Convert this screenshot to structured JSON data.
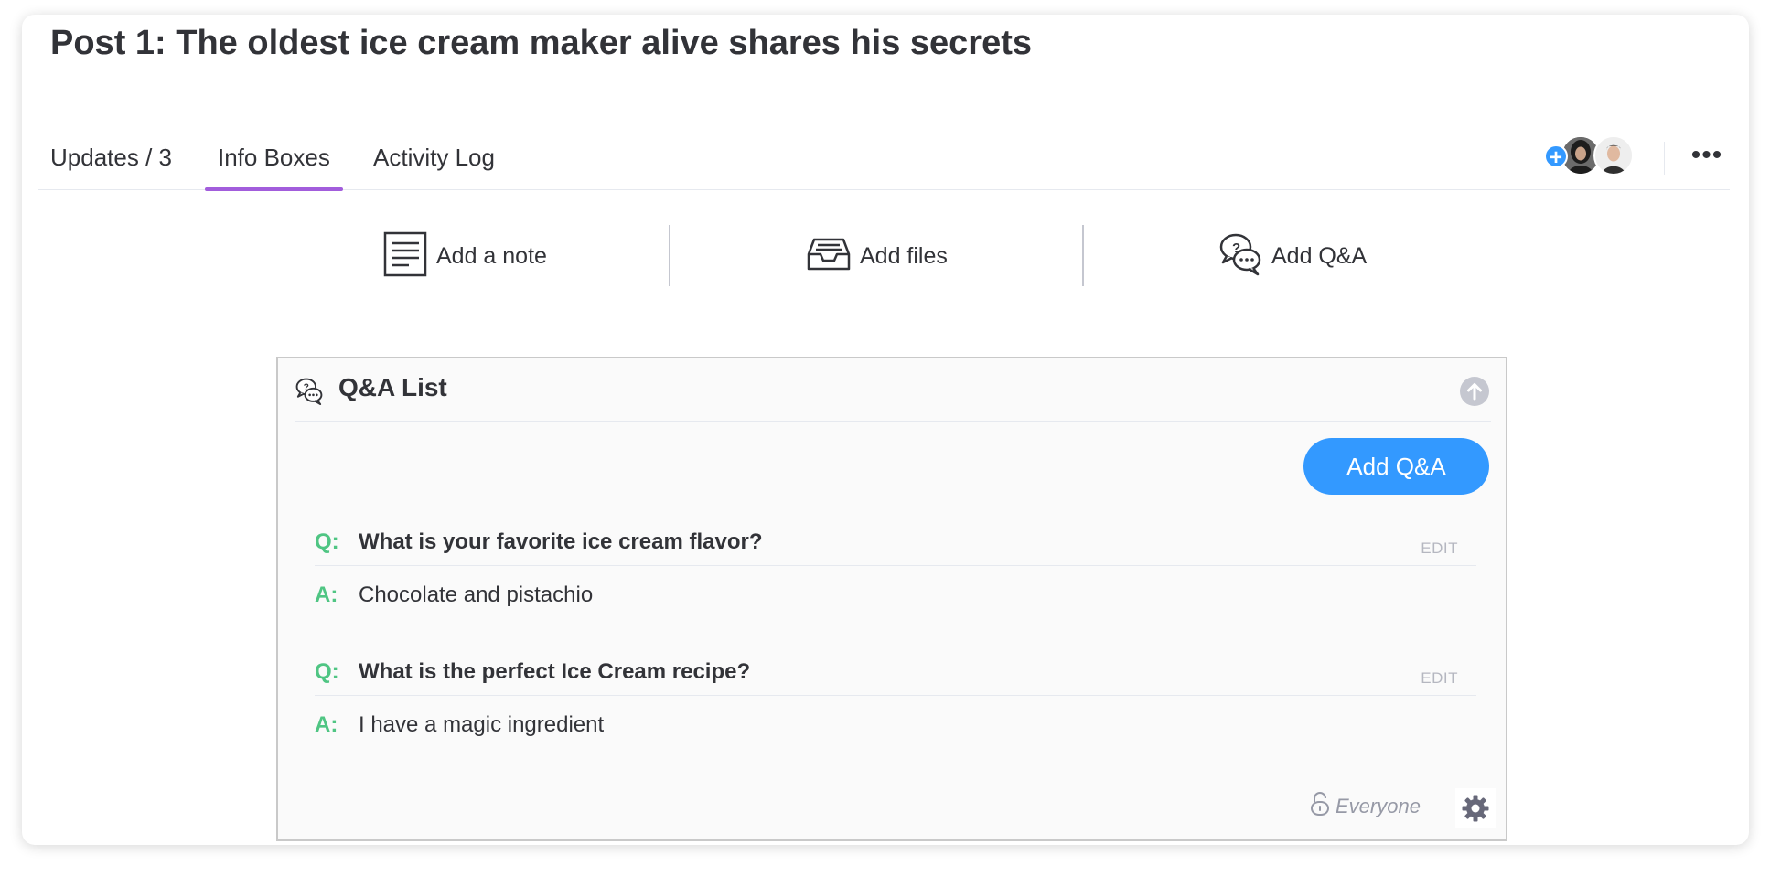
{
  "page": {
    "title": "Post 1: The oldest ice cream maker alive shares his secrets"
  },
  "tabs": [
    {
      "label": "Updates / 3",
      "active": false
    },
    {
      "label": "Info Boxes",
      "active": true
    },
    {
      "label": "Activity Log",
      "active": false
    }
  ],
  "header_actions": {
    "add_member_icon": "plus-icon",
    "more_icon": "more-dots-icon",
    "more_label": "•••"
  },
  "adders": {
    "note": {
      "label": "Add a note",
      "icon": "note-icon"
    },
    "files": {
      "label": "Add files",
      "icon": "inbox-tray-icon"
    },
    "qa": {
      "label": "Add Q&A",
      "icon": "chat-bubbles-icon"
    }
  },
  "qa_list": {
    "title": "Q&A List",
    "add_button": "Add Q&A",
    "items": [
      {
        "q_prefix": "Q:",
        "question": "What is your favorite ice cream flavor?",
        "a_prefix": "A:",
        "answer": "Chocolate and pistachio",
        "edit_label": "EDIT"
      },
      {
        "q_prefix": "Q:",
        "question": "What is the perfect Ice Cream recipe?",
        "a_prefix": "A:",
        "answer": "I have a magic ingredient",
        "edit_label": "EDIT"
      }
    ],
    "permission": "Everyone"
  },
  "colors": {
    "accent_tab": "#a25ddc",
    "primary_button": "#3399ff",
    "qa_prefix": "#4fc583",
    "text": "#323338"
  }
}
